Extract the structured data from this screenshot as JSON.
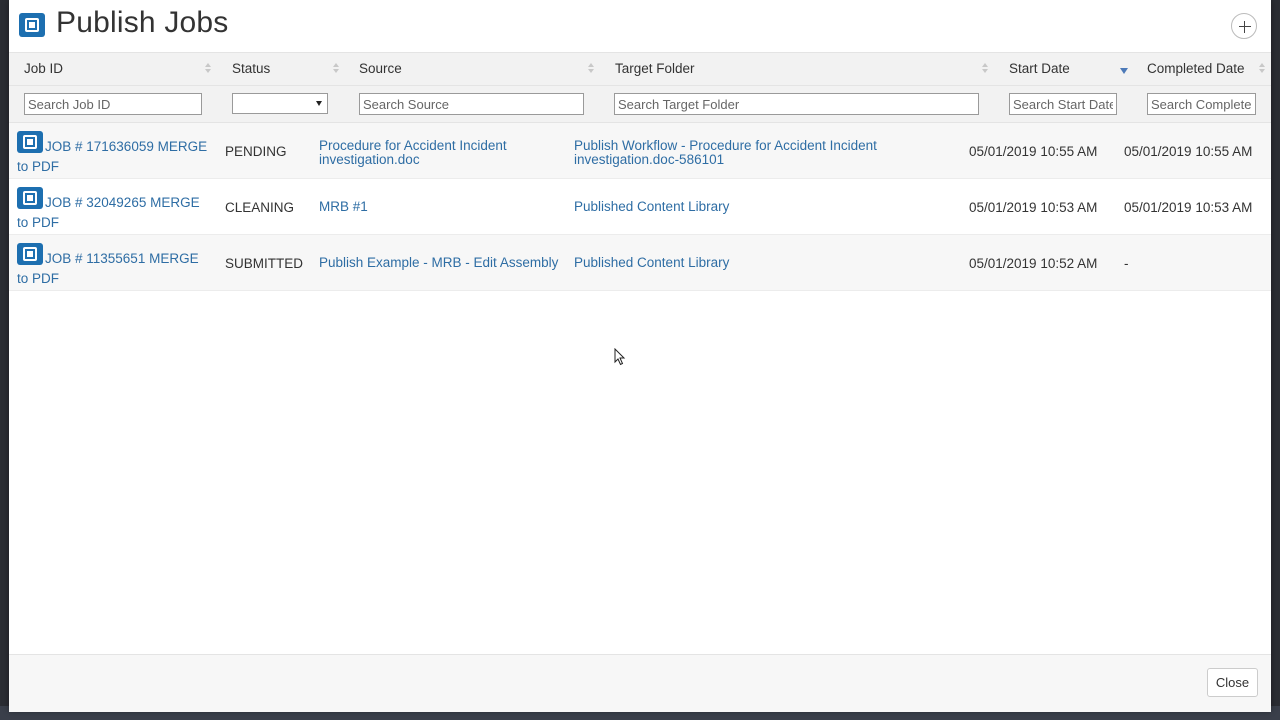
{
  "modal": {
    "title": "Publish Jobs",
    "close_label": "Close"
  },
  "table": {
    "columns": [
      "Job ID",
      "Status",
      "Source",
      "Target Folder",
      "Start Date",
      "Completed Date"
    ],
    "sorted_column": "Start Date",
    "sort_direction": "descending",
    "filters": {
      "job_id_placeholder": "Search Job ID",
      "status_value": "",
      "source_placeholder": "Search Source",
      "target_placeholder": "Search Target Folder",
      "start_date_placeholder": "Search Start Date",
      "completed_placeholder": "Search Completed Date"
    },
    "rows": [
      {
        "job": "JOB # 171636059 MERGE to PDF",
        "status": "PENDING",
        "source": "Procedure for Accident Incident investigation.doc",
        "target": "Publish Workflow - Procedure for Accident Incident investigation.doc-586101",
        "start_date": "05/01/2019 10:55 AM",
        "completed_date": "05/01/2019 10:55 AM"
      },
      {
        "job": "JOB # 32049265 MERGE to PDF",
        "status": "CLEANING",
        "source": "MRB #1",
        "target": "Published Content Library",
        "start_date": "05/01/2019 10:53 AM",
        "completed_date": "05/01/2019 10:53 AM"
      },
      {
        "job": "JOB # 11355651 MERGE to PDF",
        "status": "SUBMITTED",
        "source": "Publish Example - MRB - Edit Assembly",
        "target": "Published Content Library",
        "start_date": "05/01/2019 10:52 AM",
        "completed_date": "-"
      }
    ]
  },
  "colors": {
    "accent": "#1d6fb0",
    "link": "#2e6da4",
    "header_bg": "#f2f2f2",
    "sort_indicator": "#4d7ab8"
  },
  "icons": {
    "app": "publish-job-icon",
    "expand": "plus-circle-icon",
    "row": "publish-job-icon"
  }
}
